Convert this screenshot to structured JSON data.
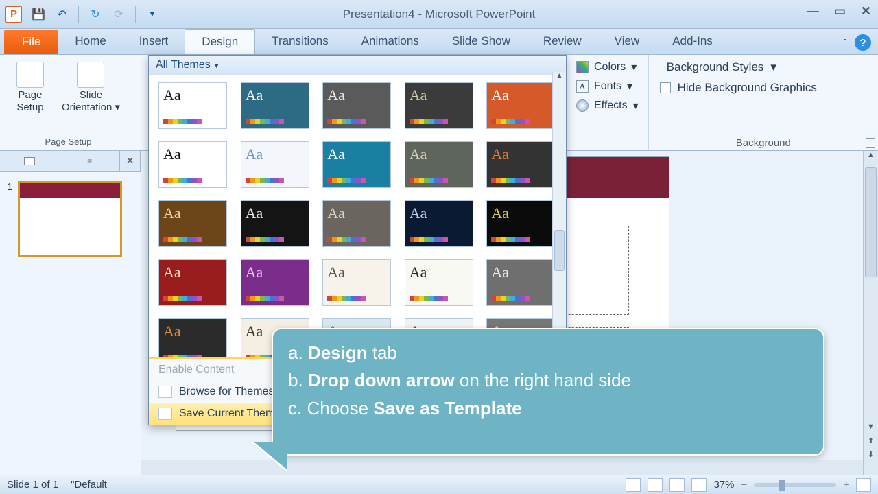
{
  "titlebar": {
    "title": "Presentation4  -  Microsoft PowerPoint"
  },
  "tabs": {
    "file": "File",
    "items": [
      "Home",
      "Insert",
      "Design",
      "Transitions",
      "Animations",
      "Slide Show",
      "Review",
      "View",
      "Add-Ins"
    ],
    "active": "Design"
  },
  "ribbon": {
    "page_setup_group": "Page Setup",
    "page_setup": "Page\nSetup",
    "slide_orientation": "Slide\nOrientation",
    "themes_header": "All Themes",
    "colors": "Colors",
    "fonts": "Fonts",
    "effects": "Effects",
    "bg_styles": "Background Styles",
    "hide_bg": "Hide Background Graphics",
    "bg_group": "Background"
  },
  "themes_menu": {
    "enable": "Enable Content",
    "browse": "Browse for Themes...",
    "save": "Save Current Theme..."
  },
  "thumb": {
    "num": "1"
  },
  "status": {
    "slide": "Slide 1 of 1",
    "theme": "\"Default",
    "zoom": "37%"
  },
  "callout": {
    "a_pre": "a. ",
    "a_b": "Design",
    "a_post": " tab",
    "b_pre": "b. ",
    "b_b": "Drop down arrow",
    "b_post": " on the right hand side",
    "c_pre": "c. Choose ",
    "c_b": "Save as Template",
    "c_post": ""
  },
  "theme_thumbs": [
    {
      "bg": "#ffffff",
      "fg": "#1a1a1a"
    },
    {
      "bg": "#2d6b84",
      "fg": "#ffffff"
    },
    {
      "bg": "#5a5a5a",
      "fg": "#e8e8e8"
    },
    {
      "bg": "#3b3b3b",
      "fg": "#d7c9a8"
    },
    {
      "bg": "#d65a29",
      "fg": "#ffffff"
    },
    {
      "bg": "#ffffff",
      "fg": "#111"
    },
    {
      "bg": "#f3f6fa",
      "fg": "#6a90c9"
    },
    {
      "bg": "#1b7ea3",
      "fg": "#ffffff"
    },
    {
      "bg": "#5e655d",
      "fg": "#d8d2be"
    },
    {
      "bg": "#333",
      "fg": "#e07838"
    },
    {
      "bg": "#6d4518",
      "fg": "#e9d6b4"
    },
    {
      "bg": "#141414",
      "fg": "#e8e8e8"
    },
    {
      "bg": "#6a665f",
      "fg": "#d9d3c6"
    },
    {
      "bg": "#0b1a33",
      "fg": "#bcd4ef"
    },
    {
      "bg": "#0a0a0a",
      "fg": "#e7c23a"
    },
    {
      "bg": "#9a1d1d",
      "fg": "#f0e3c2"
    },
    {
      "bg": "#7a2d8a",
      "fg": "#efc7f5"
    },
    {
      "bg": "#f7f3ea",
      "fg": "#555"
    },
    {
      "bg": "#f9f9f4",
      "fg": "#222"
    },
    {
      "bg": "#6f6f6f",
      "fg": "#e8e8e8"
    },
    {
      "bg": "#2b2b2b",
      "fg": "#e08a2e"
    },
    {
      "bg": "#f4efe2",
      "fg": "#333"
    },
    {
      "bg": "#d9e7ef",
      "fg": "#3a5770"
    },
    {
      "bg": "#eef3f6",
      "fg": "#444"
    },
    {
      "bg": "#777",
      "fg": "#eee"
    },
    {
      "bg": "#6d8a86",
      "fg": "#d9e3df"
    },
    {
      "bg": "#efe6bd",
      "fg": "#6a5a1e"
    },
    {
      "bg": "#fff",
      "fg": "#333"
    },
    {
      "bg": "#fff",
      "fg": "#333"
    },
    {
      "bg": "#fff",
      "fg": "#333"
    }
  ],
  "palette": [
    "#c44",
    "#e91",
    "#ec3",
    "#7b4",
    "#4ad",
    "#47c",
    "#85c",
    "#c5a"
  ]
}
